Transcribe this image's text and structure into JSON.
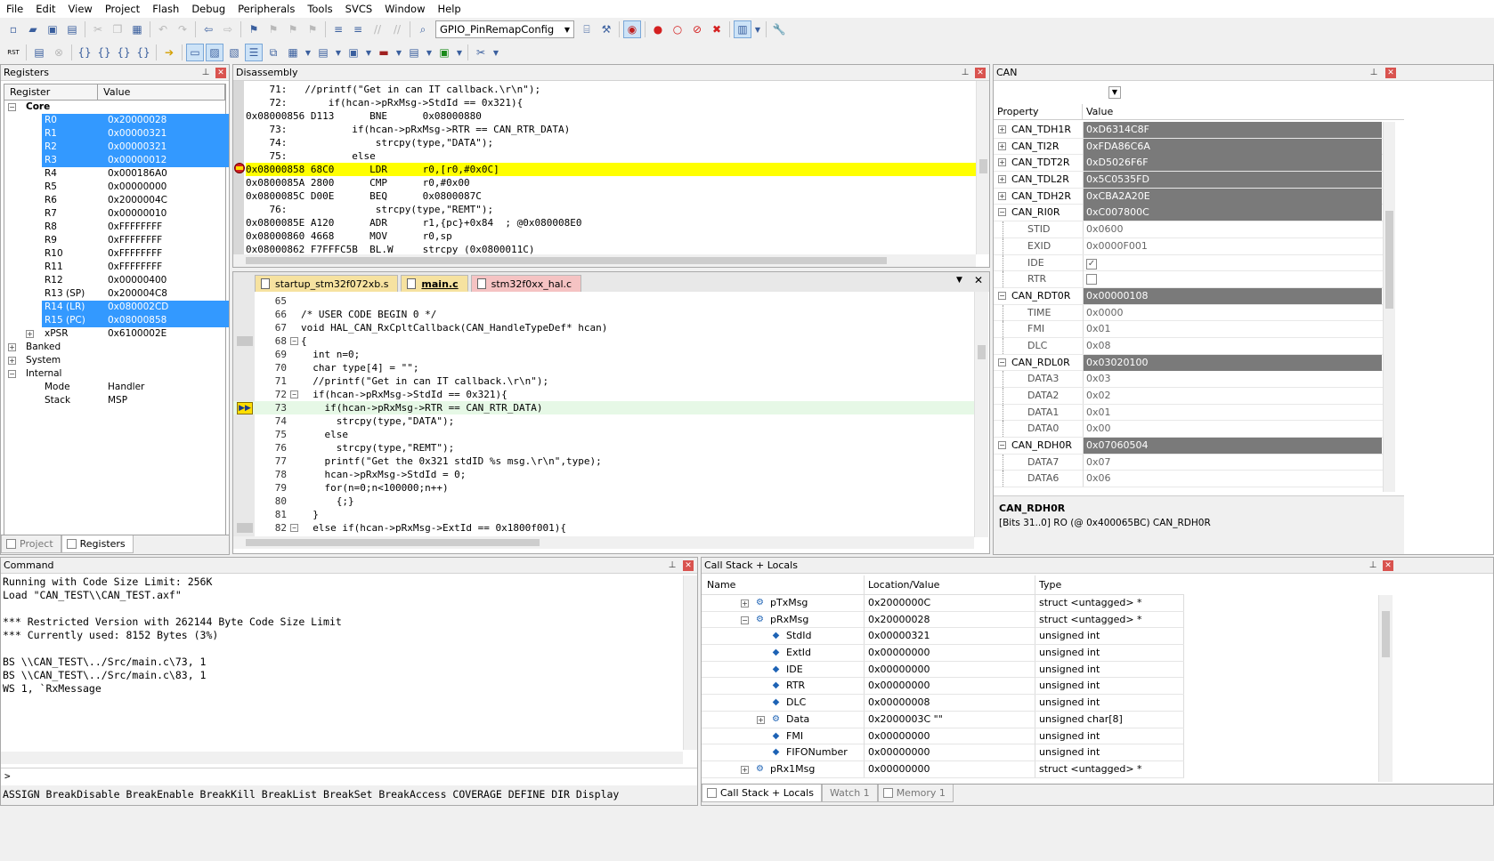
{
  "menu": [
    "File",
    "Edit",
    "View",
    "Project",
    "Flash",
    "Debug",
    "Peripherals",
    "Tools",
    "SVCS",
    "Window",
    "Help"
  ],
  "toolbar": {
    "target_combo": "GPIO_PinRemapConfig"
  },
  "registers": {
    "title": "Registers",
    "col_register": "Register",
    "col_value": "Value",
    "core_label": "Core",
    "rows": [
      {
        "name": "R0",
        "value": "0x20000028",
        "sel": true
      },
      {
        "name": "R1",
        "value": "0x00000321",
        "sel": true
      },
      {
        "name": "R2",
        "value": "0x00000321",
        "sel": true
      },
      {
        "name": "R3",
        "value": "0x00000012",
        "sel": true
      },
      {
        "name": "R4",
        "value": "0x000186A0",
        "sel": false
      },
      {
        "name": "R5",
        "value": "0x00000000",
        "sel": false
      },
      {
        "name": "R6",
        "value": "0x2000004C",
        "sel": false
      },
      {
        "name": "R7",
        "value": "0x00000010",
        "sel": false
      },
      {
        "name": "R8",
        "value": "0xFFFFFFFF",
        "sel": false
      },
      {
        "name": "R9",
        "value": "0xFFFFFFFF",
        "sel": false
      },
      {
        "name": "R10",
        "value": "0xFFFFFFFF",
        "sel": false
      },
      {
        "name": "R11",
        "value": "0xFFFFFFFF",
        "sel": false
      },
      {
        "name": "R12",
        "value": "0x00000400",
        "sel": false
      },
      {
        "name": "R13 (SP)",
        "value": "0x200004C8",
        "sel": false
      },
      {
        "name": "R14 (LR)",
        "value": "0x080002CD",
        "sel": true
      },
      {
        "name": "R15 (PC)",
        "value": "0x08000858",
        "sel": true
      }
    ],
    "xpsr_name": "xPSR",
    "xpsr_value": "0x6100002E",
    "banked": "Banked",
    "system": "System",
    "internal": "Internal",
    "mode_name": "Mode",
    "mode_value": "Handler",
    "stack_name": "Stack",
    "stack_value": "MSP",
    "tab_project": "Project",
    "tab_registers": "Registers"
  },
  "disassembly": {
    "title": "Disassembly",
    "lines": [
      "    71:   //printf(\"Get in can IT callback.\\r\\n\");",
      "    72:       if(hcan->pRxMsg->StdId == 0x321){",
      "0x08000856 D113      BNE      0x08000880",
      "    73:           if(hcan->pRxMsg->RTR == CAN_RTR_DATA)",
      "    74:               strcpy(type,\"DATA\");",
      "    75:           else",
      "0x08000858 68C0      LDR      r0,[r0,#0x0C]",
      "0x0800085A 2800      CMP      r0,#0x00",
      "0x0800085C D00E      BEQ      0x0800087C",
      "    76:               strcpy(type,\"REMT\");",
      "0x0800085E A120      ADR      r1,{pc}+0x84  ; @0x080008E0",
      "0x08000860 4668      MOV      r0,sp",
      "0x08000862 F7FFFC5B  BL.W     strcpy (0x0800011C)"
    ]
  },
  "editor": {
    "tabs": [
      "startup_stm32f072xb.s",
      "main.c",
      "stm32f0xx_hal.c"
    ],
    "lines": [
      {
        "n": "65",
        "t": ""
      },
      {
        "n": "66",
        "t": "/* USER CODE BEGIN 0 */"
      },
      {
        "n": "67",
        "t": "void HAL_CAN_RxCpltCallback(CAN_HandleTypeDef* hcan)"
      },
      {
        "n": "68",
        "t": "{"
      },
      {
        "n": "69",
        "t": "  int n=0;"
      },
      {
        "n": "70",
        "t": "  char type[4] = \"\";"
      },
      {
        "n": "71",
        "t": "  //printf(\"Get in can IT callback.\\r\\n\");"
      },
      {
        "n": "72",
        "t": "  if(hcan->pRxMsg->StdId == 0x321){"
      },
      {
        "n": "73",
        "t": "    if(hcan->pRxMsg->RTR == CAN_RTR_DATA)"
      },
      {
        "n": "74",
        "t": "      strcpy(type,\"DATA\");"
      },
      {
        "n": "75",
        "t": "    else"
      },
      {
        "n": "76",
        "t": "      strcpy(type,\"REMT\");"
      },
      {
        "n": "77",
        "t": "    printf(\"Get the 0x321 stdID %s msg.\\r\\n\",type);"
      },
      {
        "n": "78",
        "t": "    hcan->pRxMsg->StdId = 0;"
      },
      {
        "n": "79",
        "t": "    for(n=0;n<100000;n++)"
      },
      {
        "n": "80",
        "t": "      {;}"
      },
      {
        "n": "81",
        "t": "  }"
      },
      {
        "n": "82",
        "t": "  else if(hcan->pRxMsg->ExtId == 0x1800f001){"
      }
    ]
  },
  "can": {
    "title": "CAN",
    "col_property": "Property",
    "col_value": "Value",
    "rows": [
      {
        "name": "CAN_TDH1R",
        "value": "0xD6314C8F",
        "kind": "grp",
        "exp": "+"
      },
      {
        "name": "CAN_TI2R",
        "value": "0xFDA86C6A",
        "kind": "grp",
        "exp": "+"
      },
      {
        "name": "CAN_TDT2R",
        "value": "0xD5026F6F",
        "kind": "grp",
        "exp": "+"
      },
      {
        "name": "CAN_TDL2R",
        "value": "0x5C0535FD",
        "kind": "grp",
        "exp": "+"
      },
      {
        "name": "CAN_TDH2R",
        "value": "0xCBA2A20E",
        "kind": "grp",
        "exp": "+"
      },
      {
        "name": "CAN_RI0R",
        "value": "0xC007800C",
        "kind": "grp",
        "exp": "-"
      },
      {
        "name": "STID",
        "value": "0x0600",
        "kind": "sub"
      },
      {
        "name": "EXID",
        "value": "0x0000F001",
        "kind": "sub"
      },
      {
        "name": "IDE",
        "value": "",
        "kind": "chk",
        "checked": true
      },
      {
        "name": "RTR",
        "value": "",
        "kind": "chk",
        "checked": false
      },
      {
        "name": "CAN_RDT0R",
        "value": "0x00000108",
        "kind": "grp",
        "exp": "-"
      },
      {
        "name": "TIME",
        "value": "0x0000",
        "kind": "sub"
      },
      {
        "name": "FMI",
        "value": "0x01",
        "kind": "sub"
      },
      {
        "name": "DLC",
        "value": "0x08",
        "kind": "sub"
      },
      {
        "name": "CAN_RDL0R",
        "value": "0x03020100",
        "kind": "grp",
        "exp": "-"
      },
      {
        "name": "DATA3",
        "value": "0x03",
        "kind": "sub"
      },
      {
        "name": "DATA2",
        "value": "0x02",
        "kind": "sub"
      },
      {
        "name": "DATA1",
        "value": "0x01",
        "kind": "sub"
      },
      {
        "name": "DATA0",
        "value": "0x00",
        "kind": "sub"
      },
      {
        "name": "CAN_RDH0R",
        "value": "0x07060504",
        "kind": "grp",
        "exp": "-"
      },
      {
        "name": "DATA7",
        "value": "0x07",
        "kind": "sub"
      },
      {
        "name": "DATA6",
        "value": "0x06",
        "kind": "sub"
      }
    ],
    "desc_title": "CAN_RDH0R",
    "desc_text": "[Bits 31..0] RO (@ 0x400065BC) CAN_RDH0R"
  },
  "command": {
    "title": "Command",
    "lines": [
      "Running with Code Size Limit: 256K",
      "Load \"CAN_TEST\\\\CAN_TEST.axf\"",
      "",
      "*** Restricted Version with 262144 Byte Code Size Limit",
      "*** Currently used: 8152 Bytes (3%)",
      "",
      "BS \\\\CAN_TEST\\../Src/main.c\\73, 1",
      "BS \\\\CAN_TEST\\../Src/main.c\\83, 1",
      "WS 1, `RxMessage"
    ],
    "prompt": ">",
    "hints": "ASSIGN BreakDisable BreakEnable BreakKill BreakList BreakSet BreakAccess COVERAGE DEFINE DIR Display"
  },
  "callstack": {
    "title": "Call Stack + Locals",
    "col_name": "Name",
    "col_loc": "Location/Value",
    "col_type": "Type",
    "rows": [
      {
        "name": "pTxMsg",
        "loc": "0x2000000C",
        "type": "struct <untagged> *",
        "indent": 0,
        "exp": "+"
      },
      {
        "name": "pRxMsg",
        "loc": "0x20000028",
        "type": "struct <untagged> *",
        "indent": 0,
        "exp": "-"
      },
      {
        "name": "StdId",
        "loc": "0x00000321",
        "type": "unsigned int",
        "indent": 1,
        "exp": ""
      },
      {
        "name": "ExtId",
        "loc": "0x00000000",
        "type": "unsigned int",
        "indent": 1,
        "exp": ""
      },
      {
        "name": "IDE",
        "loc": "0x00000000",
        "type": "unsigned int",
        "indent": 1,
        "exp": ""
      },
      {
        "name": "RTR",
        "loc": "0x00000000",
        "type": "unsigned int",
        "indent": 1,
        "exp": ""
      },
      {
        "name": "DLC",
        "loc": "0x00000008",
        "type": "unsigned int",
        "indent": 1,
        "exp": ""
      },
      {
        "name": "Data",
        "loc": "0x2000003C \"\"",
        "type": "unsigned char[8]",
        "indent": 1,
        "exp": "+"
      },
      {
        "name": "FMI",
        "loc": "0x00000000",
        "type": "unsigned int",
        "indent": 1,
        "exp": ""
      },
      {
        "name": "FIFONumber",
        "loc": "0x00000000",
        "type": "unsigned int",
        "indent": 1,
        "exp": ""
      },
      {
        "name": "pRx1Msg",
        "loc": "0x00000000",
        "type": "struct <untagged> *",
        "indent": 0,
        "exp": "+"
      }
    ],
    "tabs": [
      "Call Stack + Locals",
      "Watch 1",
      "Memory 1"
    ]
  }
}
